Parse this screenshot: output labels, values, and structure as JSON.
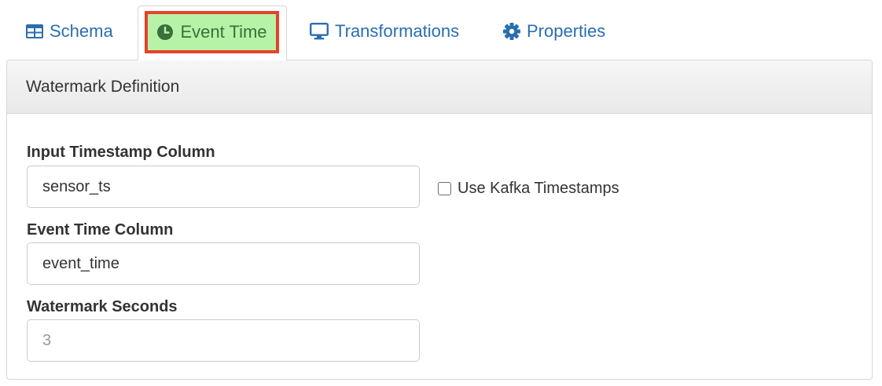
{
  "tabs": {
    "schema": "Schema",
    "event_time": "Event Time",
    "transformations": "Transformations",
    "properties": "Properties",
    "active": "event_time",
    "highlight_color": "#b7f3a7",
    "highlight_border": "#e8412a",
    "link_color": "#2a6eb0"
  },
  "panel": {
    "title": "Watermark Definition"
  },
  "form": {
    "input_timestamp_label": "Input Timestamp Column",
    "input_timestamp_value": "sensor_ts",
    "use_kafka_label": "Use Kafka Timestamps",
    "use_kafka_checked": false,
    "event_time_label": "Event Time Column",
    "event_time_value": "event_time",
    "watermark_label": "Watermark Seconds",
    "watermark_placeholder": "3"
  }
}
